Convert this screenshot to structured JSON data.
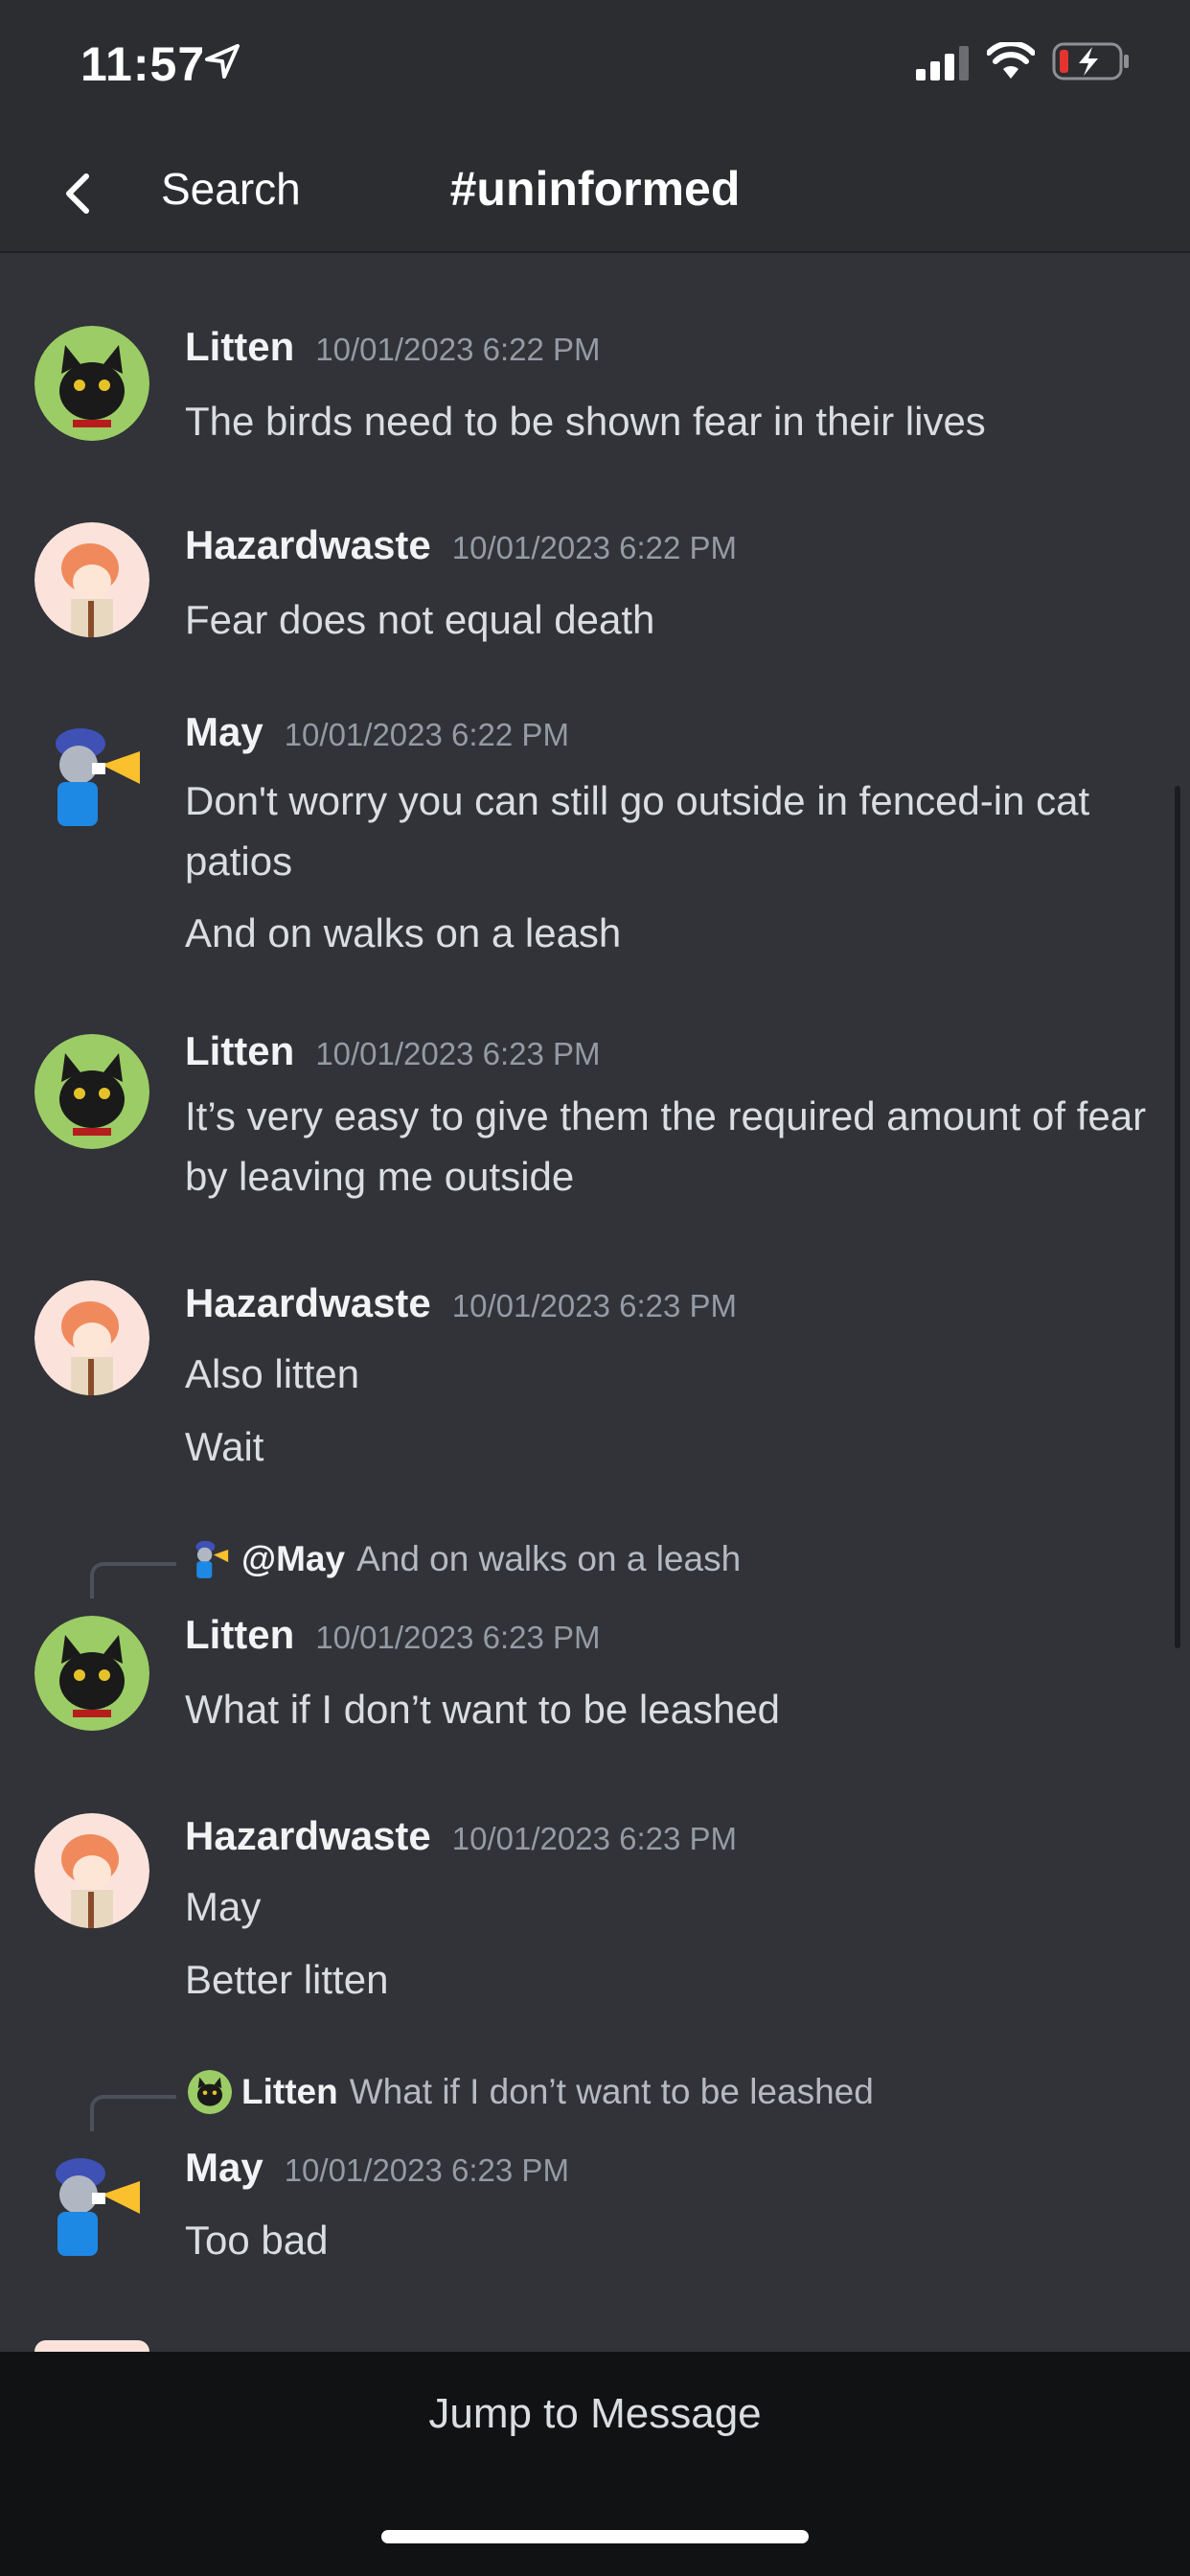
{
  "status_bar": {
    "time": "11:57",
    "battery_color": "#e3342f"
  },
  "header": {
    "back_label": "Search",
    "channel": "#uninformed"
  },
  "messages": [
    {
      "author": "Litten",
      "timestamp": "10/01/2023 6:22 PM",
      "lines": [
        "The birds need to be shown fear in their lives"
      ]
    },
    {
      "author": "Hazardwaste",
      "timestamp": "10/01/2023 6:22 PM",
      "lines": [
        "Fear does not equal death"
      ]
    },
    {
      "author": "May",
      "timestamp": "10/01/2023 6:22 PM",
      "lines": [
        "Don't worry you can still go outside in fenced-in cat patios",
        "And on walks on a leash"
      ]
    },
    {
      "author": "Litten",
      "timestamp": "10/01/2023 6:23 PM",
      "lines": [
        "It’s very easy to give them the required amount of fear by leaving me outside"
      ]
    },
    {
      "author": "Hazardwaste",
      "timestamp": "10/01/2023 6:23 PM",
      "lines": [
        "Also litten",
        "Wait"
      ]
    },
    {
      "reply": {
        "author": "@May",
        "text": "And on walks on a leash"
      },
      "author": "Litten",
      "timestamp": "10/01/2023 6:23 PM",
      "lines": [
        "What if I don’t want to be leashed"
      ]
    },
    {
      "author": "Hazardwaste",
      "timestamp": "10/01/2023 6:23 PM",
      "lines": [
        "May",
        "Better litten"
      ]
    },
    {
      "reply": {
        "author": "Litten",
        "text": "What if I don’t want to be leashed"
      },
      "author": "May",
      "timestamp": "10/01/2023 6:23 PM",
      "lines": [
        "Too bad"
      ]
    }
  ],
  "bottom": {
    "jump_label": "Jump to Message"
  },
  "colors": {
    "background": "#313338",
    "header": "#2b2d31",
    "bottom_bar": "#111214"
  }
}
